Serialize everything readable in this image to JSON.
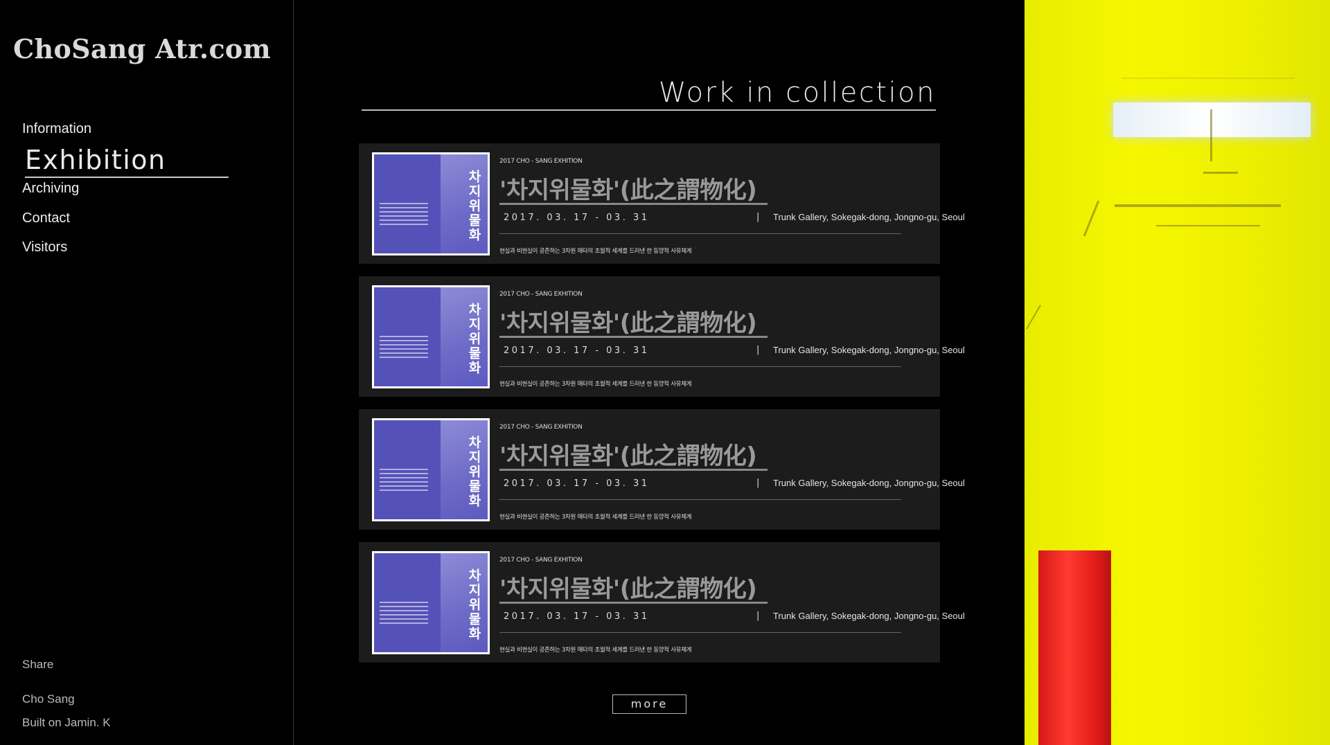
{
  "site": {
    "logo": "ChoSang Atr.com"
  },
  "nav": {
    "items": [
      {
        "label": "Information",
        "active": false
      },
      {
        "label": "Exhibition",
        "active": true
      },
      {
        "label": "Archiving",
        "active": false
      },
      {
        "label": "Contact",
        "active": false
      },
      {
        "label": "Visitors",
        "active": false
      }
    ]
  },
  "sidebar_footer": {
    "share": "Share",
    "author": "Cho Sang",
    "built": "Built on Jamin. K"
  },
  "main": {
    "title": "Work in collection",
    "cards": [
      {
        "meta": "2017   CHO - SANG   EXHITION",
        "title": "'차지위물화'(此之謂物化)",
        "dates": "2017. 03. 17  -  03. 31",
        "separator": "|",
        "venue": "Trunk Gallery, Sokegak-dong, Jongno-gu, Seoul",
        "description": "현실과 비현실이 공존하는 3차원 매타의 초월적 세계를 드러낸 한 동양적 사유체계",
        "poster_text": "차지위물화"
      },
      {
        "meta": "2017   CHO - SANG   EXHITION",
        "title": "'차지위물화'(此之謂物化)",
        "dates": "2017. 03. 17  -  03. 31",
        "separator": "|",
        "venue": "Trunk Gallery, Sokegak-dong, Jongno-gu, Seoul",
        "description": "현실과 비현실이 공존하는 3차원 매타의 초월적 세계를 드러낸 한 동양적 사유체계",
        "poster_text": "차지위물화"
      },
      {
        "meta": "2017   CHO - SANG   EXHITION",
        "title": "'차지위물화'(此之謂物化)",
        "dates": "2017. 03. 17  -  03. 31",
        "separator": "|",
        "venue": "Trunk Gallery, Sokegak-dong, Jongno-gu, Seoul",
        "description": "현실과 비현실이 공존하는 3차원 매타의 초월적 세계를 드러낸 한 동양적 사유체계",
        "poster_text": "차지위물화"
      },
      {
        "meta": "2017   CHO - SANG   EXHITION",
        "title": "'차지위물화'(此之謂物化)",
        "dates": "2017. 03. 17  -  03. 31",
        "separator": "|",
        "venue": "Trunk Gallery, Sokegak-dong, Jongno-gu, Seoul",
        "description": "현실과 비현실이 공존하는 3차원 매타의 초월적 세계를 드러낸 한 동양적 사유체계",
        "poster_text": "차지위물화"
      }
    ],
    "more_label": "more"
  },
  "colors": {
    "background": "#000000",
    "card": "#1c1c1c",
    "poster": "#5451b8",
    "art_yellow": "#eef000",
    "art_red": "#e21a1a"
  }
}
